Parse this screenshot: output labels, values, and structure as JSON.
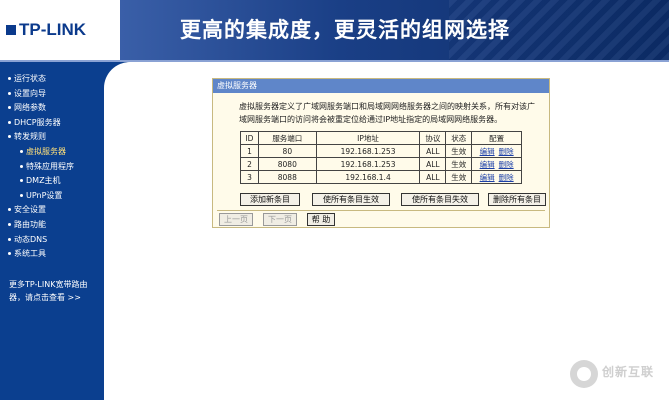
{
  "header": {
    "logo": "TP-LINK",
    "slogan": "更高的集成度，更灵活的组网选择"
  },
  "sidebar": {
    "items": [
      {
        "label": "运行状态",
        "sub": false
      },
      {
        "label": "设置向导",
        "sub": false
      },
      {
        "label": "网络参数",
        "sub": false
      },
      {
        "label": "DHCP服务器",
        "sub": false
      },
      {
        "label": "转发规则",
        "sub": false
      },
      {
        "label": "虚拟服务器",
        "sub": true,
        "current": true
      },
      {
        "label": "特殊应用程序",
        "sub": true
      },
      {
        "label": "DMZ主机",
        "sub": true
      },
      {
        "label": "UPnP设置",
        "sub": true
      },
      {
        "label": "安全设置",
        "sub": false
      },
      {
        "label": "路由功能",
        "sub": false
      },
      {
        "label": "动态DNS",
        "sub": false
      },
      {
        "label": "系统工具",
        "sub": false
      }
    ],
    "more_line1": "更多TP-LINK宽带路由",
    "more_line2": "器，请点击查看 >>"
  },
  "panel": {
    "title": "虚拟服务器",
    "description": "虚拟服务器定义了广域网服务端口和局域网网络服务器之间的映射关系，所有对该广域网服务端口的访问将会被重定位给通过IP地址指定的局域网网络服务器。",
    "table": {
      "headers": [
        "ID",
        "服务端口",
        "IP地址",
        "协议",
        "状态",
        "配置"
      ],
      "rows": [
        {
          "id": "1",
          "port": "80",
          "ip": "192.168.1.253",
          "protocol": "ALL",
          "status": "生效",
          "edit": "编辑",
          "delete": "删除"
        },
        {
          "id": "2",
          "port": "8080",
          "ip": "192.168.1.253",
          "protocol": "ALL",
          "status": "生效",
          "edit": "编辑",
          "delete": "删除"
        },
        {
          "id": "3",
          "port": "8088",
          "ip": "192.168.1.4",
          "protocol": "ALL",
          "status": "生效",
          "edit": "编辑",
          "delete": "删除"
        }
      ]
    },
    "buttons": {
      "add": "添加新条目",
      "enable_all": "使所有条目生效",
      "disable_all": "使所有条目失效",
      "delete_all": "删除所有条目"
    },
    "pager": {
      "prev": "上一页",
      "next": "下一页",
      "help": "帮 助"
    }
  },
  "watermark": "创新互联",
  "colors": {
    "header_bg": "#0b2f6e",
    "sidebar_bg": "#0b3f8f",
    "panel_title_bg": "#5f86c9",
    "panel_bg": "#fffbea",
    "link": "#1b3fa8"
  }
}
